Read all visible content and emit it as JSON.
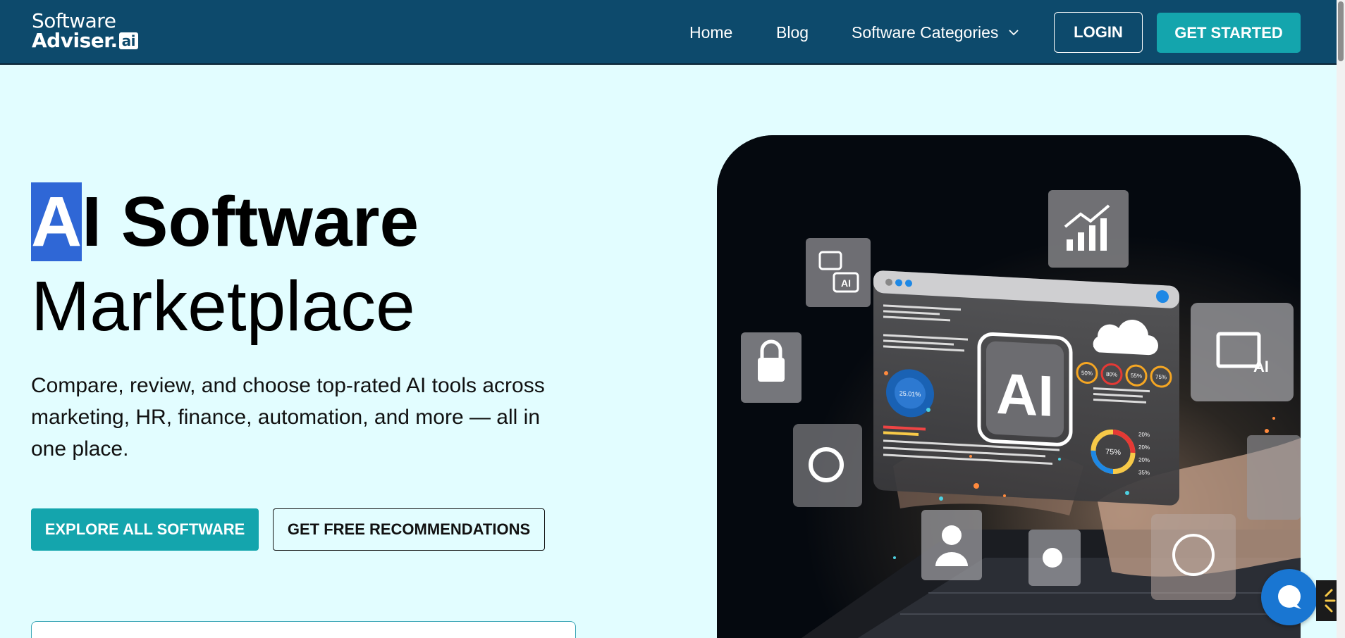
{
  "header": {
    "logo_line1": "Software",
    "logo_line2": "Adviser.",
    "logo_badge": "ai",
    "nav": {
      "home": "Home",
      "blog": "Blog",
      "categories": "Software Categories"
    },
    "login_label": "LOGIN",
    "get_started_label": "GET STARTED"
  },
  "hero": {
    "title_selected": "A",
    "title_line1_rest": "I Software",
    "title_line2": "Marketplace",
    "description": "Compare, review, and choose top-rated AI tools across marketing, HR, finance, automation, and more — all in one place.",
    "explore_label": "EXPLORE ALL SOFTWARE",
    "recommend_label": "GET FREE RECOMMENDATIONS"
  },
  "image": {
    "center_badge": "AI",
    "chip_chat": "AI",
    "chip_gallery": "AI",
    "donut_value": "25.01%",
    "donut_value2": "75%",
    "gauges": [
      "50%",
      "80%",
      "55%",
      "75%"
    ],
    "legend_values": [
      "20%",
      "20%",
      "20%",
      "35%"
    ]
  },
  "colors": {
    "header_bg": "#0d4a6c",
    "accent": "#14a5ad",
    "page_bg": "#e2fdff",
    "selection": "#2f67d6",
    "chat": "#1976d2"
  },
  "icons": [
    "chevron-down-icon",
    "chat-icon",
    "lock-icon",
    "chart-icon",
    "gallery-icon",
    "gear-icon",
    "user-icon",
    "robot-icon",
    "globe-icon",
    "cloud-sync-icon"
  ]
}
